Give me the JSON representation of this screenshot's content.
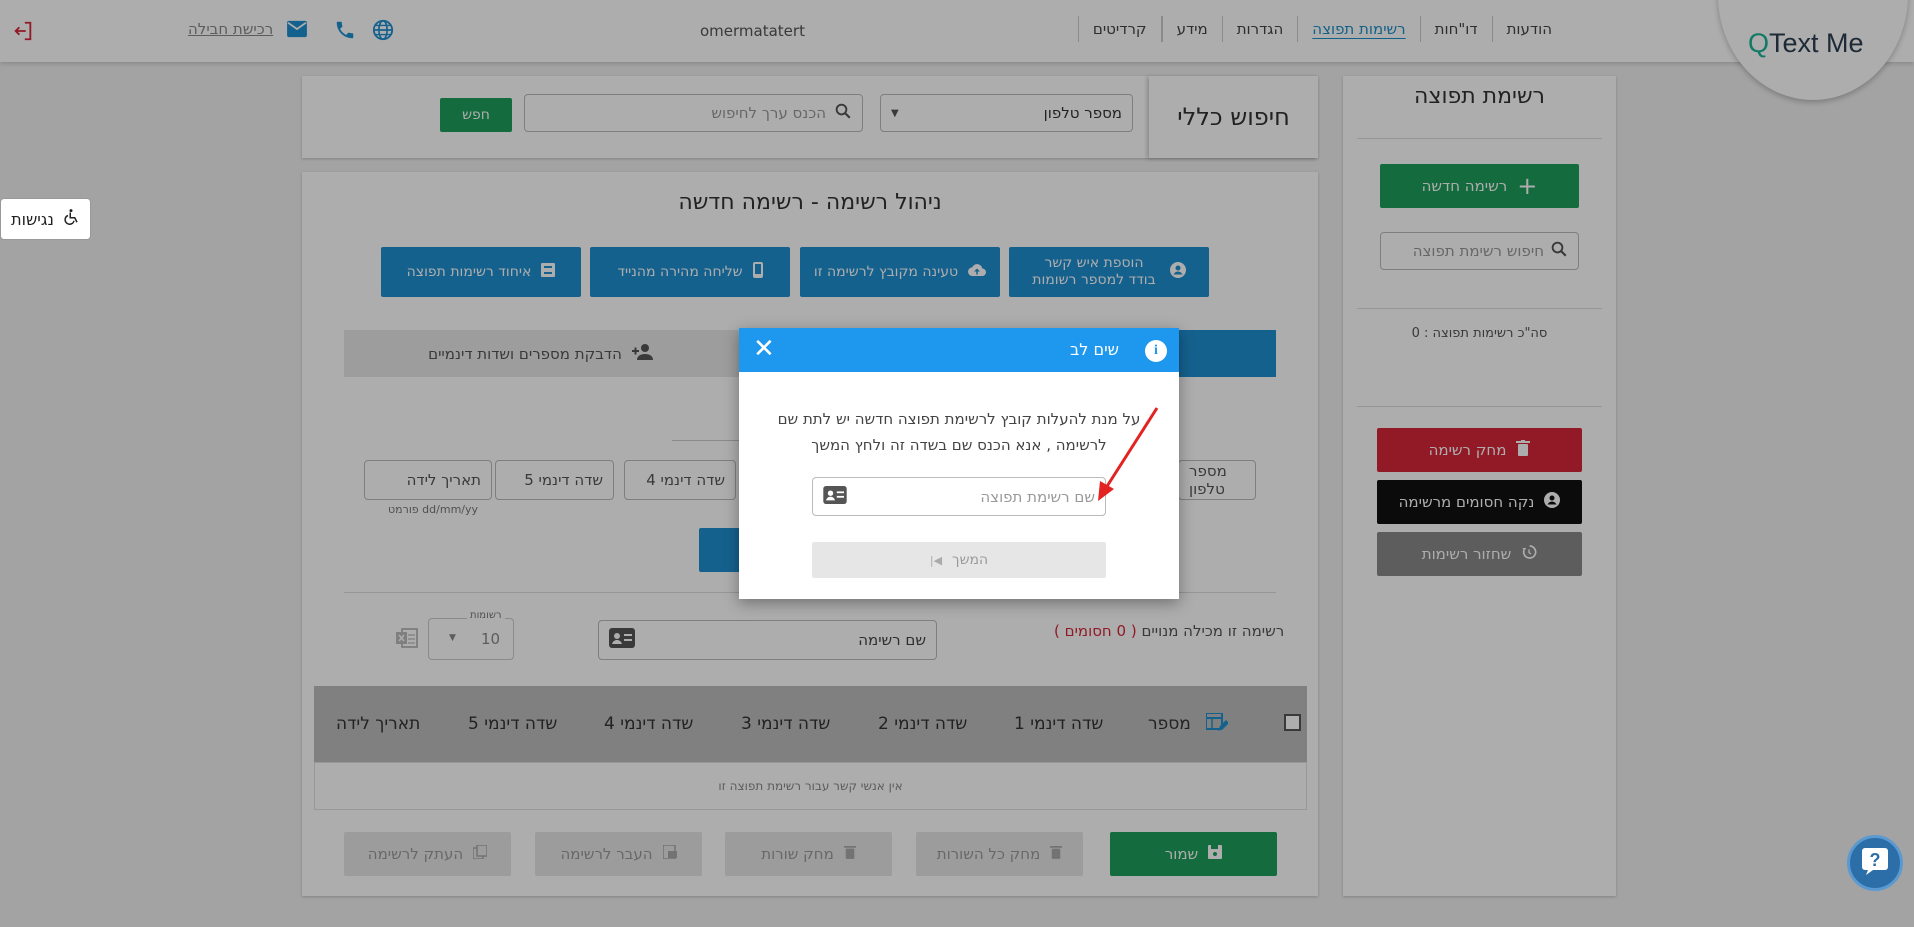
{
  "header": {
    "logo": {
      "prefix": "Q",
      "text": "Text Me"
    },
    "nav": [
      {
        "label": "הודעות"
      },
      {
        "label": "דו\"חות"
      },
      {
        "label": "רשימות תפוצה"
      },
      {
        "label": "הגדרות"
      },
      {
        "label": "מידע"
      },
      {
        "label": "קרדיטים"
      }
    ],
    "username": "omermatatert",
    "buy_credit": "רכישת חבילה"
  },
  "sidebar": {
    "title": "רשימת תפוצה",
    "new_list": "רשימה חדשה",
    "search_placeholder": "חיפוש רשימת תפוצה",
    "total": "סה\"כ רשימות תפוצה : 0",
    "delete_list": "מחק רשימה",
    "clear_blocked": "נקה חסומים מרשימה",
    "restore_list": "שחזור רשימות"
  },
  "search_panel": {
    "title": "חיפוש כללי",
    "field_select": "מספר טלפון",
    "search_placeholder": "הכנס ערך לחיפוש",
    "search_button": "חפש"
  },
  "manage": {
    "title": "ניהול רשימה - רשימה חדשה",
    "actions": [
      {
        "line1": "הוספת איש קשר",
        "line2": "בודד למספר רשומות"
      },
      {
        "line1": "טעינה מקובץ לרשימה זו",
        "line2": ""
      },
      {
        "line1": "שליחה מהירה מהנייד",
        "line2": ""
      },
      {
        "line1": "איחוד רשימות תפוצה",
        "line2": ""
      }
    ],
    "tab_paste": "הדבקת מספרים ושדות דינמיים",
    "fields": [
      "מספר טלפון",
      "שדה דינמי 4",
      "שדה דינמי 5",
      "תאריך לידה"
    ],
    "date_format": "פורמט dd/mm/yy",
    "list_info_prefix": "רשימה זו מכילה מנויים",
    "list_info_blocked": "( 0 חסומים )",
    "list_name_placeholder": "שם רשימה",
    "records_label": "רשומות",
    "records_value": "10",
    "table_headers": [
      "מספר",
      "שדה דינמי 1",
      "שדה דינמי 2",
      "שדה דינמי 3",
      "שדה דינמי 4",
      "שדה דינמי 5",
      "תאריך לידה"
    ],
    "empty_message": "אין אנשי קשר עבור רשימת תפוצה זו",
    "save": "שמור",
    "delete_all_rows": "מחק כל השורות",
    "delete_rows": "מחק שורות",
    "move_to_list": "העבר לרשימה",
    "copy_to_list": "העתק לרשימה"
  },
  "modal": {
    "title": "שים לב",
    "message": "על מנת להעלות קובץ לרשימת תפוצה חדשה יש לתת שם לרשימה , אנא הכנס שם בשדה זה ולחץ המשך",
    "name_placeholder": "שם רשימת תפוצה",
    "continue": "המשך"
  },
  "accessibility": "נגישות",
  "colors": {
    "primary": "#1f8fd1",
    "header": "#1e98ef",
    "success": "#1e9e5b",
    "danger": "#d72638",
    "arrow": "#e32222"
  }
}
